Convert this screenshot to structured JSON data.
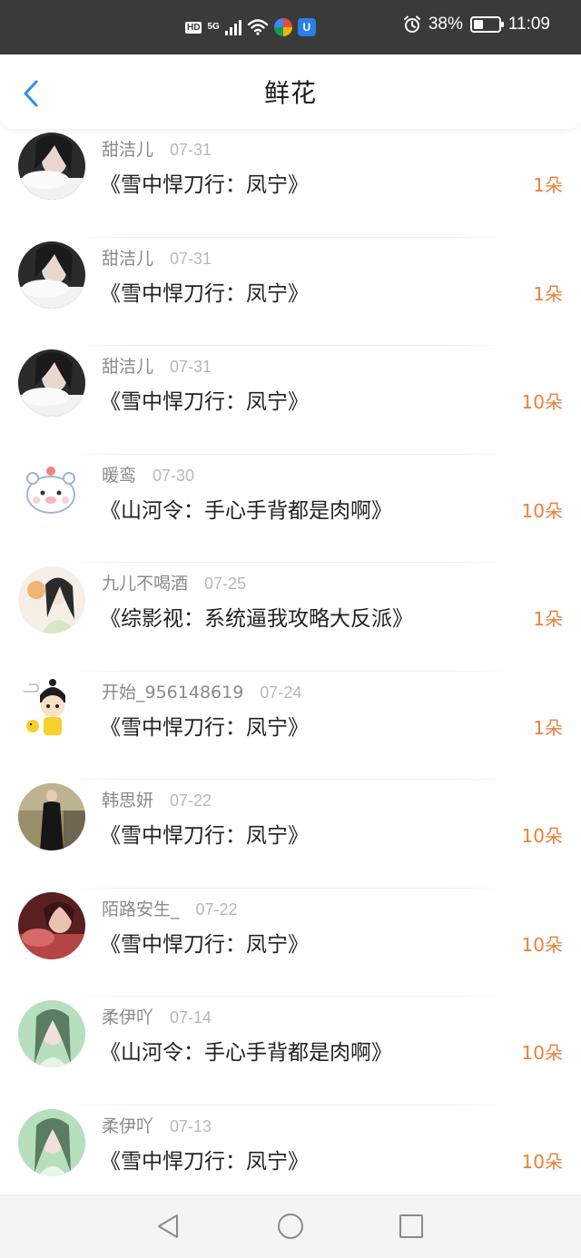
{
  "status_bar": {
    "hd": "HD",
    "network": "5G",
    "battery_percent": "38%",
    "battery_level": 0.38,
    "time": "11:09",
    "icons": [
      "signal-icon",
      "wifi-icon",
      "app-notification-icon",
      "shield-app-icon",
      "alarm-icon",
      "battery-icon"
    ]
  },
  "header": {
    "title": "鲜花",
    "back_icon": "chevron-left-icon",
    "accent": "#2a8ff0"
  },
  "list": {
    "count_color": "#e8813a",
    "items": [
      {
        "name": "甜洁儿",
        "date": "07-31",
        "book": "《雪中悍刀行：凤宁》",
        "count": "1朵",
        "avatar": "photo-girl-dark-hair"
      },
      {
        "name": "甜洁儿",
        "date": "07-31",
        "book": "《雪中悍刀行：凤宁》",
        "count": "1朵",
        "avatar": "photo-girl-dark-hair"
      },
      {
        "name": "甜洁儿",
        "date": "07-31",
        "book": "《雪中悍刀行：凤宁》",
        "count": "10朵",
        "avatar": "photo-girl-dark-hair"
      },
      {
        "name": "暖鸾",
        "date": "07-30",
        "book": "《山河令：手心手背都是肉啊》",
        "count": "10朵",
        "avatar": "cartoon-bear"
      },
      {
        "name": "九儿不喝酒",
        "date": "07-25",
        "book": "《综影视：系统逼我攻略大反派》",
        "count": "1朵",
        "avatar": "illustrated-girl"
      },
      {
        "name": "开始_956148619",
        "date": "07-24",
        "book": "《雪中悍刀行：凤宁》",
        "count": "1朵",
        "avatar": "cartoon-boy"
      },
      {
        "name": "韩思妍",
        "date": "07-22",
        "book": "《雪中悍刀行：凤宁》",
        "count": "10朵",
        "avatar": "photo-woman-black-dress"
      },
      {
        "name": "陌路安生_",
        "date": "07-22",
        "book": "《雪中悍刀行：凤宁》",
        "count": "10朵",
        "avatar": "photo-woman-red"
      },
      {
        "name": "柔伊吖",
        "date": "07-14",
        "book": "《山河令：手心手背都是肉啊》",
        "count": "10朵",
        "avatar": "photo-woman-green"
      },
      {
        "name": "柔伊吖",
        "date": "07-13",
        "book": "《雪中悍刀行：凤宁》",
        "count": "10朵",
        "avatar": "photo-woman-green"
      }
    ]
  },
  "nav_bar": {
    "buttons": [
      "back-triangle-icon",
      "home-circle-icon",
      "recents-square-icon"
    ]
  }
}
